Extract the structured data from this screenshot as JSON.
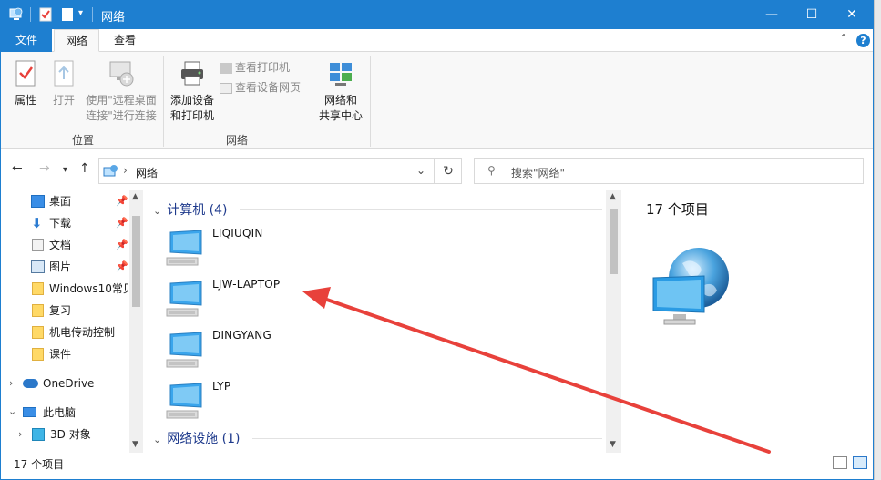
{
  "window": {
    "title": "网络"
  },
  "tabs": {
    "file": "文件",
    "network": "网络",
    "view": "查看"
  },
  "ribbon": {
    "properties": "属性",
    "open": "打开",
    "remote_line1": "使用\"远程桌面",
    "remote_line2": "连接\"进行连接",
    "group_location": "位置",
    "add_device_line1": "添加设备",
    "add_device_line2": "和打印机",
    "view_printers": "查看打印机",
    "view_device_page": "查看设备网页",
    "group_network": "网络",
    "sharing_line1": "网络和",
    "sharing_line2": "共享中心"
  },
  "address": {
    "path": "网络",
    "search_placeholder": "搜索\"网络\""
  },
  "nav": {
    "quick": [
      "桌面",
      "下载",
      "文档",
      "图片",
      "Windows10常见",
      "复习",
      "机电传动控制",
      "课件"
    ],
    "onedrive": "OneDrive",
    "thispc": "此电脑",
    "objects3d": "3D 对象"
  },
  "content": {
    "group_computers": "计算机 (4)",
    "computers": [
      "LIQIUQIN",
      "LJW-LAPTOP",
      "DINGYANG",
      "LYP"
    ],
    "group_infrastructure": "网络设施 (1)"
  },
  "preview": {
    "count": "17 个项目"
  },
  "status": {
    "count": "17 个项目"
  },
  "colors": {
    "accent": "#1e7fd0",
    "annotation_arrow": "#e8413b"
  }
}
